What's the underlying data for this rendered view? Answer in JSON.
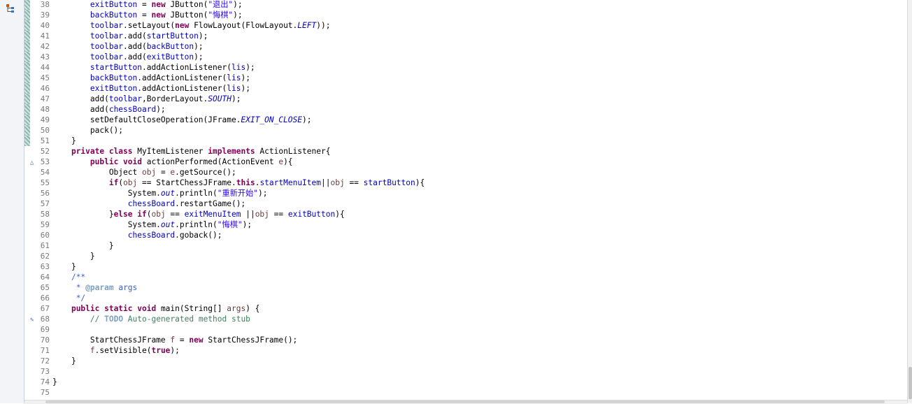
{
  "window": {
    "left_toolbar_icon": "hierarchy-icon"
  },
  "editor": {
    "lines": [
      {
        "n": "38",
        "changed": true,
        "segs": [
          [
            "p",
            "        "
          ],
          [
            "field",
            "exitButton"
          ],
          [
            "p",
            " = "
          ],
          [
            "kw",
            "new"
          ],
          [
            "p",
            " JButton("
          ],
          [
            "str",
            "\"退出\""
          ],
          [
            "p",
            ");"
          ]
        ]
      },
      {
        "n": "39",
        "changed": true,
        "segs": [
          [
            "p",
            "        "
          ],
          [
            "field",
            "backButton"
          ],
          [
            "p",
            " = "
          ],
          [
            "kw",
            "new"
          ],
          [
            "p",
            " JButton("
          ],
          [
            "str",
            "\"悔棋\""
          ],
          [
            "p",
            ");"
          ]
        ]
      },
      {
        "n": "40",
        "changed": true,
        "segs": [
          [
            "p",
            "        "
          ],
          [
            "field",
            "toolbar"
          ],
          [
            "p",
            ".setLayout("
          ],
          [
            "kw",
            "new"
          ],
          [
            "p",
            " FlowLayout(FlowLayout."
          ],
          [
            "sfield",
            "LEFT"
          ],
          [
            "p",
            "));"
          ]
        ]
      },
      {
        "n": "41",
        "changed": true,
        "segs": [
          [
            "p",
            "        "
          ],
          [
            "field",
            "toolbar"
          ],
          [
            "p",
            ".add("
          ],
          [
            "field",
            "startButton"
          ],
          [
            "p",
            ");"
          ]
        ]
      },
      {
        "n": "42",
        "changed": true,
        "segs": [
          [
            "p",
            "        "
          ],
          [
            "field",
            "toolbar"
          ],
          [
            "p",
            ".add("
          ],
          [
            "field",
            "backButton"
          ],
          [
            "p",
            ");"
          ]
        ]
      },
      {
        "n": "43",
        "changed": true,
        "segs": [
          [
            "p",
            "        "
          ],
          [
            "field",
            "toolbar"
          ],
          [
            "p",
            ".add("
          ],
          [
            "field",
            "exitButton"
          ],
          [
            "p",
            ");"
          ]
        ]
      },
      {
        "n": "44",
        "changed": true,
        "segs": [
          [
            "p",
            "        "
          ],
          [
            "field",
            "startButton"
          ],
          [
            "p",
            ".addActionListener("
          ],
          [
            "field",
            "lis"
          ],
          [
            "p",
            ");"
          ]
        ]
      },
      {
        "n": "45",
        "changed": true,
        "segs": [
          [
            "p",
            "        "
          ],
          [
            "field",
            "backButton"
          ],
          [
            "p",
            ".addActionListener("
          ],
          [
            "field",
            "lis"
          ],
          [
            "p",
            ");"
          ]
        ]
      },
      {
        "n": "46",
        "changed": true,
        "segs": [
          [
            "p",
            "        "
          ],
          [
            "field",
            "exitButton"
          ],
          [
            "p",
            ".addActionListener("
          ],
          [
            "field",
            "lis"
          ],
          [
            "p",
            ");"
          ]
        ]
      },
      {
        "n": "47",
        "changed": true,
        "segs": [
          [
            "p",
            "        add("
          ],
          [
            "field",
            "toolbar"
          ],
          [
            "p",
            ",BorderLayout."
          ],
          [
            "sfield",
            "SOUTH"
          ],
          [
            "p",
            ");"
          ]
        ]
      },
      {
        "n": "48",
        "changed": true,
        "segs": [
          [
            "p",
            "        add("
          ],
          [
            "field",
            "chessBoard"
          ],
          [
            "p",
            ");"
          ]
        ]
      },
      {
        "n": "49",
        "changed": true,
        "segs": [
          [
            "p",
            "        setDefaultCloseOperation(JFrame."
          ],
          [
            "sfield",
            "EXIT_ON_CLOSE"
          ],
          [
            "p",
            ");"
          ]
        ]
      },
      {
        "n": "50",
        "changed": true,
        "segs": [
          [
            "p",
            "        pack();"
          ]
        ]
      },
      {
        "n": "51",
        "changed": true,
        "segs": [
          [
            "p",
            "    }"
          ]
        ]
      },
      {
        "n": "52",
        "changed": false,
        "segs": [
          [
            "p",
            "    "
          ],
          [
            "kw",
            "private class"
          ],
          [
            "p",
            " MyItemListener "
          ],
          [
            "kw",
            "implements"
          ],
          [
            "p",
            " ActionListener{"
          ]
        ]
      },
      {
        "n": "53",
        "changed": false,
        "marker": "△",
        "segs": [
          [
            "p",
            "        "
          ],
          [
            "kw",
            "public void"
          ],
          [
            "p",
            " actionPerformed(ActionEvent "
          ],
          [
            "local",
            "e"
          ],
          [
            "p",
            "){"
          ]
        ]
      },
      {
        "n": "54",
        "changed": false,
        "segs": [
          [
            "p",
            "            Object "
          ],
          [
            "local",
            "obj"
          ],
          [
            "p",
            " = "
          ],
          [
            "local",
            "e"
          ],
          [
            "p",
            ".getSource();"
          ]
        ]
      },
      {
        "n": "55",
        "changed": false,
        "segs": [
          [
            "p",
            "            "
          ],
          [
            "kw",
            "if"
          ],
          [
            "p",
            "("
          ],
          [
            "local",
            "obj"
          ],
          [
            "p",
            " == StartChessJFrame."
          ],
          [
            "kw",
            "this"
          ],
          [
            "p",
            "."
          ],
          [
            "field",
            "startMenuItem"
          ],
          [
            "p",
            "||"
          ],
          [
            "local",
            "obj"
          ],
          [
            "p",
            " == "
          ],
          [
            "field",
            "startButton"
          ],
          [
            "p",
            "){"
          ]
        ]
      },
      {
        "n": "56",
        "changed": false,
        "segs": [
          [
            "p",
            "                System."
          ],
          [
            "sfield",
            "out"
          ],
          [
            "p",
            ".println("
          ],
          [
            "str",
            "\"重新开始\""
          ],
          [
            "p",
            ");"
          ]
        ]
      },
      {
        "n": "57",
        "changed": false,
        "segs": [
          [
            "p",
            "                "
          ],
          [
            "field",
            "chessBoard"
          ],
          [
            "p",
            ".restartGame();"
          ]
        ]
      },
      {
        "n": "58",
        "changed": false,
        "segs": [
          [
            "p",
            "            }"
          ],
          [
            "kw",
            "else if"
          ],
          [
            "p",
            "("
          ],
          [
            "local",
            "obj"
          ],
          [
            "p",
            " == "
          ],
          [
            "field",
            "exitMenuItem"
          ],
          [
            "p",
            " ||"
          ],
          [
            "local",
            "obj"
          ],
          [
            "p",
            " == "
          ],
          [
            "field",
            "exitButton"
          ],
          [
            "p",
            "){"
          ]
        ]
      },
      {
        "n": "59",
        "changed": false,
        "segs": [
          [
            "p",
            "                System."
          ],
          [
            "sfield",
            "out"
          ],
          [
            "p",
            ".println("
          ],
          [
            "str",
            "\"悔棋\""
          ],
          [
            "p",
            ");"
          ]
        ]
      },
      {
        "n": "60",
        "changed": false,
        "segs": [
          [
            "p",
            "                "
          ],
          [
            "field",
            "chessBoard"
          ],
          [
            "p",
            ".goback();"
          ]
        ]
      },
      {
        "n": "61",
        "changed": false,
        "segs": [
          [
            "p",
            "            }"
          ]
        ]
      },
      {
        "n": "62",
        "changed": false,
        "segs": [
          [
            "p",
            "        }"
          ]
        ]
      },
      {
        "n": "63",
        "changed": false,
        "segs": [
          [
            "p",
            "    }"
          ]
        ]
      },
      {
        "n": "64",
        "changed": false,
        "segs": [
          [
            "p",
            "    "
          ],
          [
            "jdoc",
            "/**"
          ]
        ]
      },
      {
        "n": "65",
        "changed": false,
        "segs": [
          [
            "p",
            "     "
          ],
          [
            "jdoc",
            "* "
          ],
          [
            "jtag",
            "@param"
          ],
          [
            "jdoc",
            " args"
          ]
        ]
      },
      {
        "n": "66",
        "changed": false,
        "segs": [
          [
            "p",
            "     "
          ],
          [
            "jdoc",
            "*/"
          ]
        ]
      },
      {
        "n": "67",
        "changed": false,
        "segs": [
          [
            "p",
            "    "
          ],
          [
            "kw",
            "public static void"
          ],
          [
            "p",
            " main(String[] "
          ],
          [
            "local",
            "args"
          ],
          [
            "p",
            ") {"
          ]
        ]
      },
      {
        "n": "68",
        "changed": false,
        "marker": "✎",
        "segs": [
          [
            "p",
            "        "
          ],
          [
            "cmt",
            "// "
          ],
          [
            "todo",
            "TODO"
          ],
          [
            "cmt",
            " Auto-generated method stub"
          ]
        ]
      },
      {
        "n": "69",
        "changed": false,
        "segs": [
          [
            "p",
            ""
          ]
        ]
      },
      {
        "n": "70",
        "changed": false,
        "segs": [
          [
            "p",
            "        StartChessJFrame "
          ],
          [
            "local",
            "f"
          ],
          [
            "p",
            " = "
          ],
          [
            "kw",
            "new"
          ],
          [
            "p",
            " StartChessJFrame();"
          ]
        ]
      },
      {
        "n": "71",
        "changed": false,
        "segs": [
          [
            "p",
            "        "
          ],
          [
            "local",
            "f"
          ],
          [
            "p",
            ".setVisible("
          ],
          [
            "kw",
            "true"
          ],
          [
            "p",
            ");"
          ]
        ]
      },
      {
        "n": "72",
        "changed": false,
        "segs": [
          [
            "p",
            "    }"
          ]
        ]
      },
      {
        "n": "73",
        "changed": false,
        "segs": [
          [
            "p",
            ""
          ]
        ]
      },
      {
        "n": "74",
        "changed": false,
        "segs": [
          [
            "p",
            "}"
          ]
        ]
      },
      {
        "n": "75",
        "changed": false,
        "segs": [
          [
            "p",
            ""
          ]
        ]
      }
    ]
  },
  "colors": {
    "keyword": "#7f0055",
    "field": "#0000c0",
    "string": "#2a00ff",
    "comment": "#3f7f5f",
    "javadoc": "#3f5fbf"
  }
}
